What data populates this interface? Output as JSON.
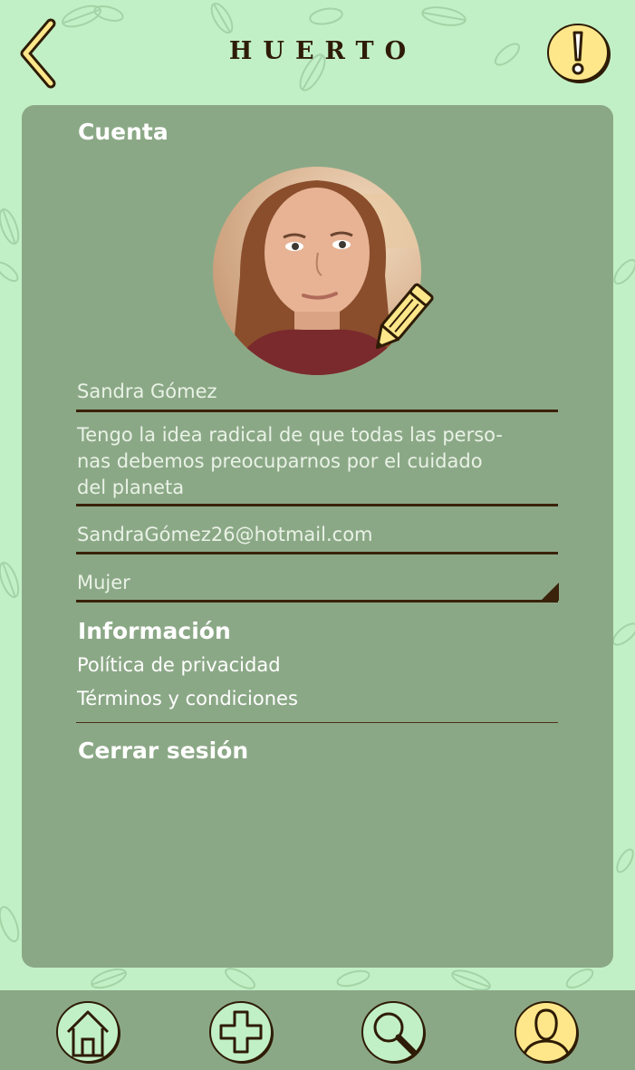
{
  "header": {
    "title": "HUERTO",
    "back_icon": "chevron-left-icon",
    "alert_icon": "exclamation-icon"
  },
  "account": {
    "heading": "Cuenta",
    "avatar_icon": "user-photo",
    "edit_icon": "pencil-icon",
    "name": "Sandra Gómez",
    "bio_lines": [
      "Tengo la idea radical de que todas las perso-",
      "nas debemos preocuparnos por el cuidado",
      "del planeta"
    ],
    "email": "SandraGómez26@hotmail.com",
    "gender": "Mujer"
  },
  "info": {
    "heading": "Información",
    "privacy": "Política de privacidad",
    "terms": "Términos y condiciones"
  },
  "logout": "Cerrar sesión",
  "tabbar": {
    "items": [
      {
        "icon": "home-icon",
        "active": false
      },
      {
        "icon": "plus-icon",
        "active": false
      },
      {
        "icon": "search-icon",
        "active": false
      },
      {
        "icon": "user-icon",
        "active": true
      }
    ]
  },
  "colors": {
    "background": "#c2f0c6",
    "panel": "#8ba886",
    "accent_yellow": "#fde78a",
    "ink": "#2e1c06",
    "field_text": "#e9f2e6",
    "tab_circle": "#c2f0c6"
  }
}
